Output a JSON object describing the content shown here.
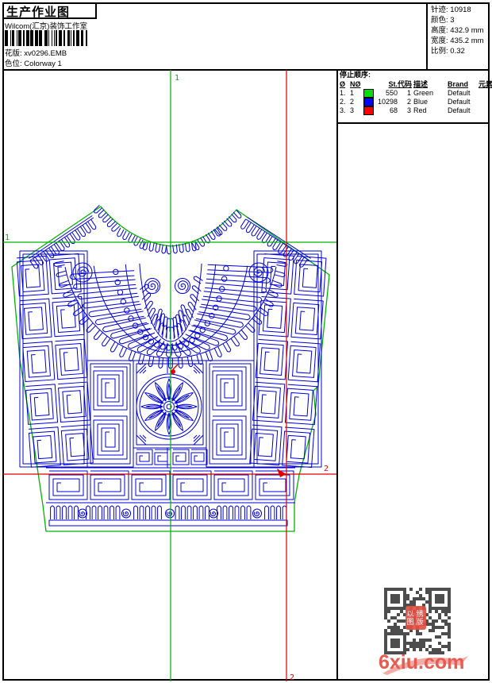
{
  "header": {
    "title": "生产作业图",
    "studio": "Wilcom(汇京)装饰工作室",
    "pattern_label": "花版:",
    "pattern_value": "xv0296.EMB",
    "colorway_label": "色位:",
    "colorway_value": "Colorway 1",
    "info_rows": [
      {
        "label": "针迹:",
        "value": "10918"
      },
      {
        "label": "颜色:",
        "value": "3"
      },
      {
        "label": "高度:",
        "value": "432.9 mm"
      },
      {
        "label": "宽度:",
        "value": "435.2 mm"
      },
      {
        "label": "比例:",
        "value": "0.32"
      }
    ]
  },
  "stop_sequence": {
    "title": "停止顺序:",
    "columns": [
      "Ø",
      "NØ",
      "St.",
      "代码",
      "描述",
      "Brand",
      "元素"
    ],
    "rows": [
      {
        "index": "1.",
        "needle": "1",
        "swatch": "#00dd00",
        "stitches": "550",
        "code": "1",
        "description": "Green",
        "brand": "Default",
        "element": ""
      },
      {
        "index": "2.",
        "needle": "2",
        "swatch": "#0000ff",
        "stitches": "10298",
        "code": "2",
        "description": "Blue",
        "brand": "Default",
        "element": ""
      },
      {
        "index": "3.",
        "needle": "3",
        "swatch": "#ff0000",
        "stitches": "68",
        "code": "3",
        "description": "Red",
        "brand": "Default",
        "element": ""
      }
    ]
  },
  "design": {
    "colors": {
      "outline": "#00b400",
      "stitches": "#0000d6",
      "guide_green": "#00b400",
      "guide_red": "#dd0000",
      "marker": "#e00000"
    },
    "guides": {
      "green_vertical_label": "1",
      "green_horizontal_label": "1",
      "red_vertical_label": "2",
      "red_horizontal_label": "2"
    }
  },
  "footer": {
    "logo_text": "6xiu.com",
    "logo_color": "#e95a50",
    "seal_chars": [
      "以",
      "绣",
      "图",
      "版"
    ]
  }
}
